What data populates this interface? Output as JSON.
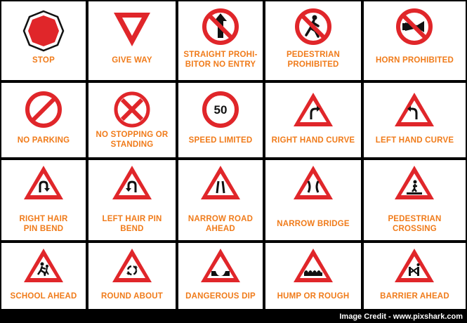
{
  "signs": [
    {
      "label": "STOP",
      "icon": "stop-sign-icon"
    },
    {
      "label": "GIVE WAY",
      "icon": "give-way-sign-icon"
    },
    {
      "label": "STRAIGHT PROHI- BITOR NO ENTRY",
      "icon": "straight-prohibitor-sign-icon"
    },
    {
      "label": "PEDESTRIAN PROHIBITED",
      "icon": "pedestrian-prohibited-sign-icon"
    },
    {
      "label": "HORN PROHIBITED",
      "icon": "horn-prohibited-sign-icon"
    },
    {
      "label": "NO PARKING",
      "icon": "no-parking-sign-icon"
    },
    {
      "label": "NO STOPPING OR STANDING",
      "icon": "no-stopping-sign-icon"
    },
    {
      "label": "SPEED LIMITED",
      "icon": "speed-limit-sign-icon",
      "value": "50"
    },
    {
      "label": "RIGHT HAND CURVE",
      "icon": "right-hand-curve-sign-icon"
    },
    {
      "label": "LEFT HAND CURVE",
      "icon": "left-hand-curve-sign-icon"
    },
    {
      "label": "RIGHT HAIR PIN BEND",
      "icon": "right-hairpin-sign-icon"
    },
    {
      "label": "LEFT HAIR PIN BEND",
      "icon": "left-hairpin-sign-icon"
    },
    {
      "label": "NARROW ROAD AHEAD",
      "icon": "narrow-road-sign-icon"
    },
    {
      "label": "NARROW BRIDGE",
      "icon": "narrow-bridge-sign-icon"
    },
    {
      "label": "PEDESTRIAN CROSSING",
      "icon": "pedestrian-crossing-sign-icon"
    },
    {
      "label": "SCHOOL AHEAD",
      "icon": "school-ahead-sign-icon"
    },
    {
      "label": "ROUND ABOUT",
      "icon": "roundabout-sign-icon"
    },
    {
      "label": "DANGEROUS DIP",
      "icon": "dangerous-dip-sign-icon"
    },
    {
      "label": "HUMP OR ROUGH",
      "icon": "hump-sign-icon"
    },
    {
      "label": "BARRIER AHEAD",
      "icon": "barrier-ahead-sign-icon"
    }
  ],
  "colors": {
    "red": "#e0262a",
    "orange": "#f07b1a",
    "black": "#111111"
  },
  "credit": "Image Credit - www.pixshark.com"
}
